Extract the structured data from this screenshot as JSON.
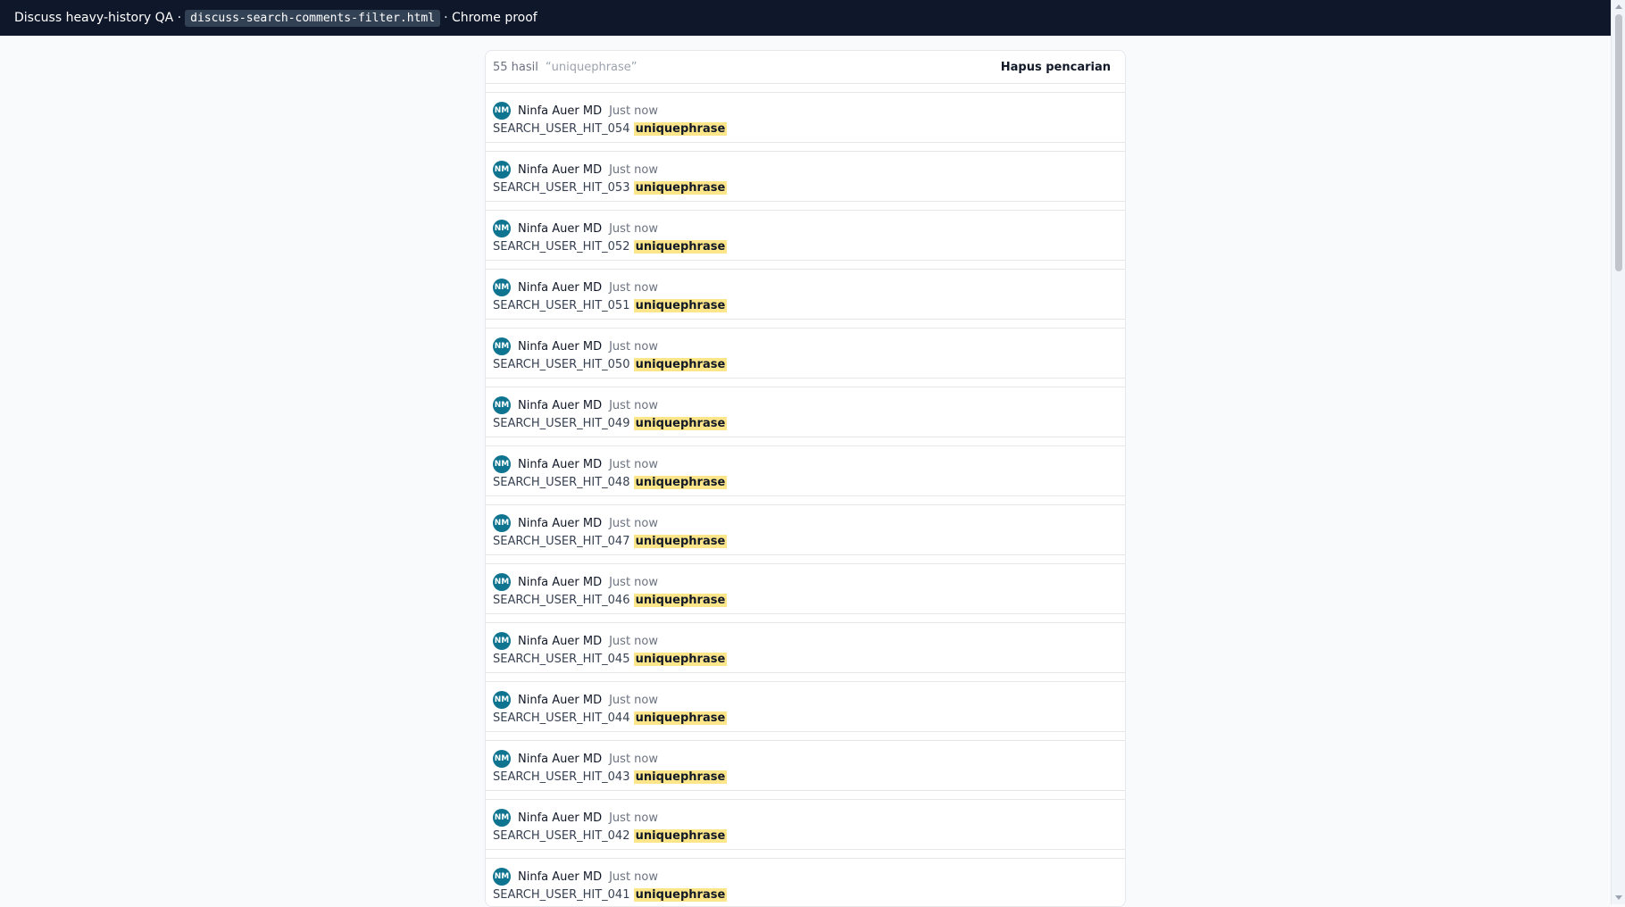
{
  "topbar": {
    "title_prefix": "Discuss heavy-history QA ·",
    "file": "discuss-search-comments-filter.html",
    "title_suffix": "· Chrome proof"
  },
  "search": {
    "count_label": "55 hasil",
    "query_label": "“uniquephrase”",
    "clear_label": "Hapus pencarian"
  },
  "results": [
    {
      "initials": "NM",
      "author": "Ninfa Auer MD",
      "time": "Just now",
      "text": "SEARCH_USER_HIT_054",
      "highlight": "uniquephrase"
    },
    {
      "initials": "NM",
      "author": "Ninfa Auer MD",
      "time": "Just now",
      "text": "SEARCH_USER_HIT_053",
      "highlight": "uniquephrase"
    },
    {
      "initials": "NM",
      "author": "Ninfa Auer MD",
      "time": "Just now",
      "text": "SEARCH_USER_HIT_052",
      "highlight": "uniquephrase"
    },
    {
      "initials": "NM",
      "author": "Ninfa Auer MD",
      "time": "Just now",
      "text": "SEARCH_USER_HIT_051",
      "highlight": "uniquephrase"
    },
    {
      "initials": "NM",
      "author": "Ninfa Auer MD",
      "time": "Just now",
      "text": "SEARCH_USER_HIT_050",
      "highlight": "uniquephrase"
    },
    {
      "initials": "NM",
      "author": "Ninfa Auer MD",
      "time": "Just now",
      "text": "SEARCH_USER_HIT_049",
      "highlight": "uniquephrase"
    },
    {
      "initials": "NM",
      "author": "Ninfa Auer MD",
      "time": "Just now",
      "text": "SEARCH_USER_HIT_048",
      "highlight": "uniquephrase"
    },
    {
      "initials": "NM",
      "author": "Ninfa Auer MD",
      "time": "Just now",
      "text": "SEARCH_USER_HIT_047",
      "highlight": "uniquephrase"
    },
    {
      "initials": "NM",
      "author": "Ninfa Auer MD",
      "time": "Just now",
      "text": "SEARCH_USER_HIT_046",
      "highlight": "uniquephrase"
    },
    {
      "initials": "NM",
      "author": "Ninfa Auer MD",
      "time": "Just now",
      "text": "SEARCH_USER_HIT_045",
      "highlight": "uniquephrase"
    },
    {
      "initials": "NM",
      "author": "Ninfa Auer MD",
      "time": "Just now",
      "text": "SEARCH_USER_HIT_044",
      "highlight": "uniquephrase"
    },
    {
      "initials": "NM",
      "author": "Ninfa Auer MD",
      "time": "Just now",
      "text": "SEARCH_USER_HIT_043",
      "highlight": "uniquephrase"
    },
    {
      "initials": "NM",
      "author": "Ninfa Auer MD",
      "time": "Just now",
      "text": "SEARCH_USER_HIT_042",
      "highlight": "uniquephrase"
    },
    {
      "initials": "NM",
      "author": "Ninfa Auer MD",
      "time": "Just now",
      "text": "SEARCH_USER_HIT_041",
      "highlight": "uniquephrase"
    }
  ]
}
